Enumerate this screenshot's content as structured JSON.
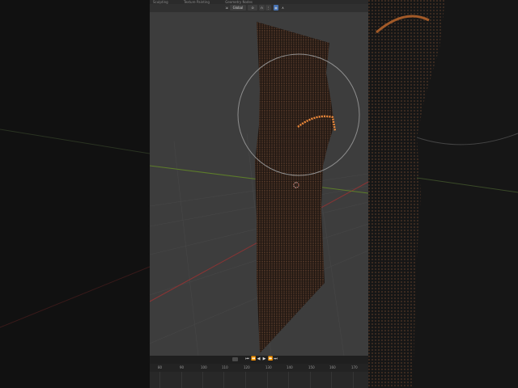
{
  "topbar": {
    "tabs": [
      "Sculpting",
      "Texture Painting",
      "Geometry Nodes"
    ]
  },
  "header": {
    "orientation_label": "Global",
    "orientation_icon": "transform-orientation-icon",
    "pivot_icon": "pivot-point-icon",
    "snap_icon": "snap-magnet-icon",
    "proportional_icon": "proportional-edit-icon",
    "falloff_icon": "falloff-curve-icon"
  },
  "viewport": {
    "object": "cloth strip mesh",
    "selection_color": "#f08a3a",
    "axis_x_color": "#8a3434",
    "axis_y_color": "#5d7d2a"
  },
  "timeline": {
    "frame_ticks": [
      "80",
      "90",
      "100",
      "110",
      "120",
      "130",
      "140",
      "150",
      "160",
      "170"
    ],
    "controls": [
      "jump-start",
      "prev-keyframe",
      "play-reverse",
      "play",
      "next-keyframe",
      "jump-end"
    ]
  },
  "colors": {
    "viewport_bg": "#3d3d3d",
    "header_bg": "#303030",
    "timeline_bg": "#262626"
  }
}
